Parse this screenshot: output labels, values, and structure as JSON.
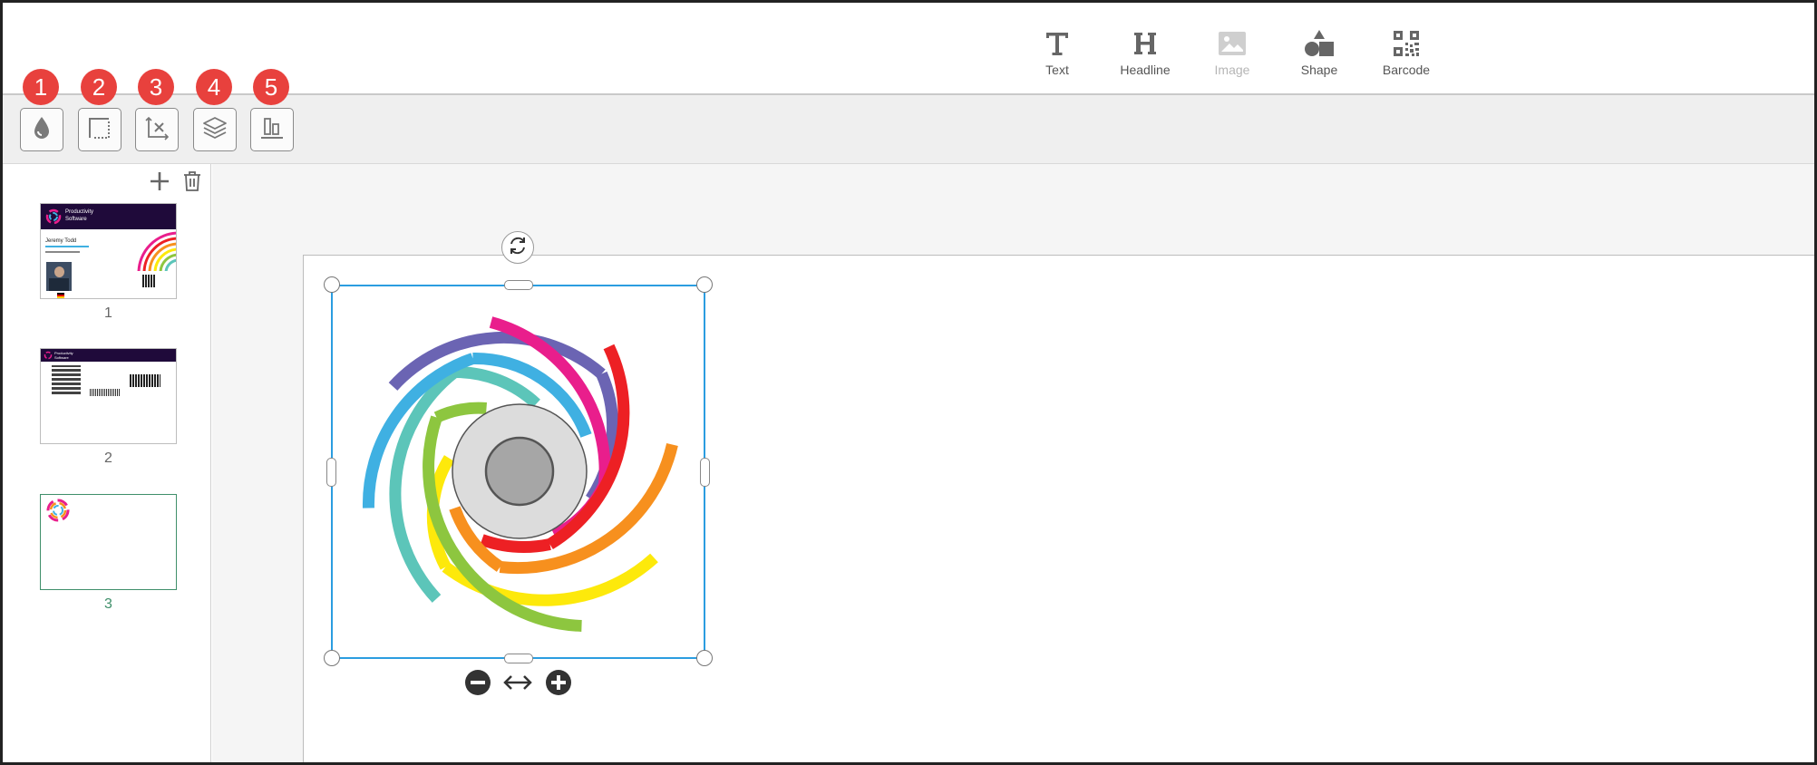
{
  "insert_tools": [
    {
      "id": "text",
      "label": "Text",
      "icon": "text-icon",
      "disabled": false
    },
    {
      "id": "headline",
      "label": "Headline",
      "icon": "headline-icon",
      "disabled": false
    },
    {
      "id": "image",
      "label": "Image",
      "icon": "image-icon",
      "disabled": true
    },
    {
      "id": "shape",
      "label": "Shape",
      "icon": "shape-icon",
      "disabled": false
    },
    {
      "id": "barcode",
      "label": "Barcode",
      "icon": "qr-code-icon",
      "disabled": false
    }
  ],
  "property_tools": [
    {
      "badge": "1",
      "icon": "fill-color-icon"
    },
    {
      "badge": "2",
      "icon": "border-icon"
    },
    {
      "badge": "3",
      "icon": "position-icon"
    },
    {
      "badge": "4",
      "icon": "layers-icon"
    },
    {
      "badge": "5",
      "icon": "align-icon"
    }
  ],
  "sidebar": {
    "actions": [
      {
        "icon": "plus-icon"
      },
      {
        "icon": "trash-icon"
      }
    ],
    "pages": [
      {
        "number": "1",
        "company_line1": "Productivity",
        "company_line2": "Software",
        "person_name": "Jeremy Todd",
        "active": false
      },
      {
        "number": "2",
        "company_line1": "Productivity",
        "company_line2": "Software",
        "active": false
      },
      {
        "number": "3",
        "active": true
      }
    ]
  },
  "canvas": {
    "selection_element": "spiral-logo",
    "controls": [
      "rotate-icon",
      "minus-circle-icon",
      "horizontal-arrows-icon",
      "plus-circle-icon"
    ]
  },
  "colors": {
    "accent_selection": "#2b9de0",
    "badge": "#e8413d",
    "header_band": "#1f0a3a",
    "active_page": "#3f8f6a",
    "spiral": [
      "#6b64b3",
      "#e91e8c",
      "#ed2024",
      "#f7901e",
      "#fde90b",
      "#8dc63f",
      "#5cc5b9",
      "#3fb0e2"
    ]
  }
}
